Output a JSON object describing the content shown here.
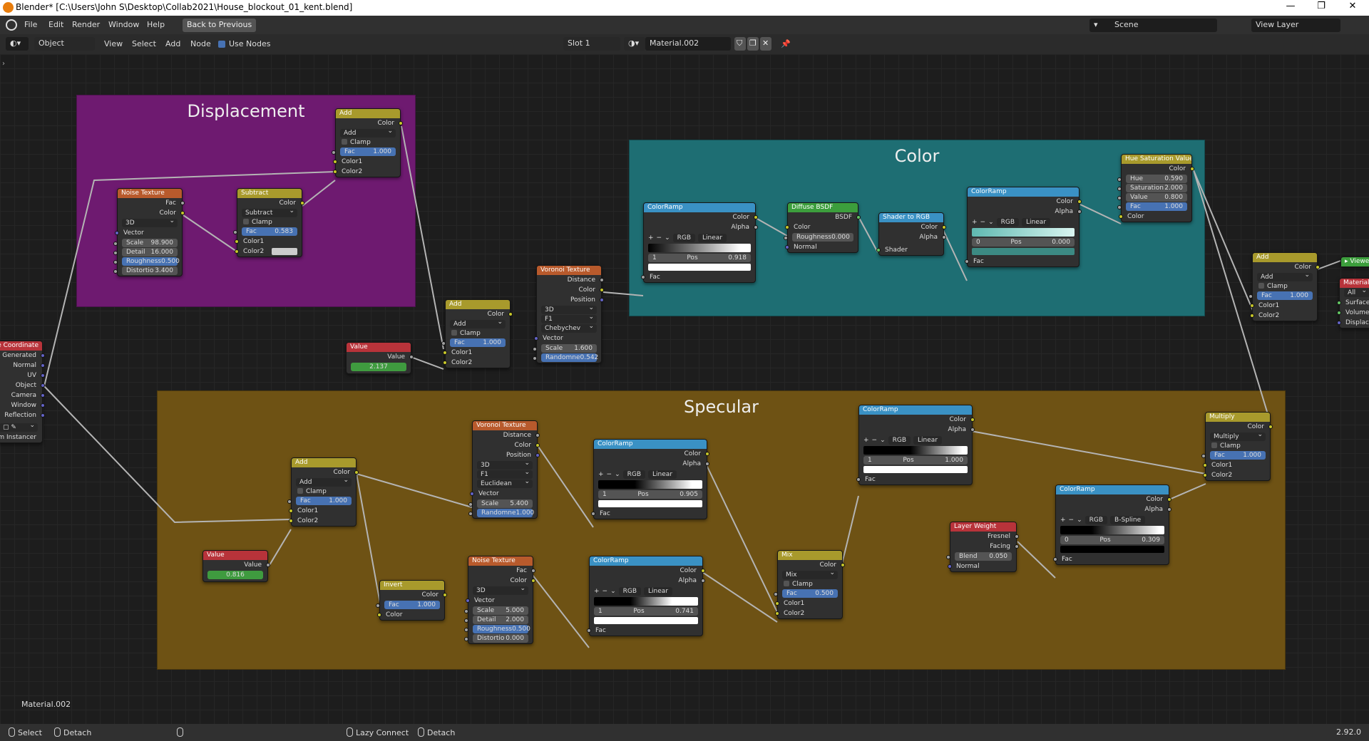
{
  "window": {
    "title": "Blender* [C:\\Users\\John S\\Desktop\\Collab2021\\House_blockout_01_kent.blend]",
    "controls": [
      "—",
      "❐",
      "✕"
    ]
  },
  "menubar": {
    "items": [
      "File",
      "Edit",
      "Render",
      "Window",
      "Help"
    ],
    "back_button": "Back to Previous",
    "scene": "Scene",
    "view_layer": "View Layer"
  },
  "header": {
    "mode": "Object",
    "menus": [
      "View",
      "Select",
      "Add",
      "Node"
    ],
    "use_nodes": "Use Nodes",
    "slot": "Slot 1",
    "material": "Material.002"
  },
  "frames": {
    "displacement": "Displacement",
    "color": "Color",
    "specular": "Specular"
  },
  "nodes": {
    "texcoord": {
      "title": "Texture Coordinate",
      "outputs": [
        "Generated",
        "Normal",
        "UV",
        "Object",
        "Camera",
        "Window",
        "Reflection"
      ],
      "instancer": "From Instancer"
    },
    "noise1": {
      "title": "Noise Texture",
      "out1": "Fac",
      "out2": "Color",
      "dim": "3D",
      "vector": "Vector",
      "scale_l": "Scale",
      "scale_v": "98.900",
      "detail_l": "Detail",
      "detail_v": "16.000",
      "rough_l": "Roughness",
      "rough_v": "0.500",
      "dist_l": "Distortio",
      "dist_v": "3.400"
    },
    "subtract": {
      "title": "Subtract",
      "out": "Color",
      "op": "Subtract",
      "clamp": "Clamp",
      "fac_l": "Fac",
      "fac_v": "0.583",
      "c1": "Color1",
      "c2": "Color2"
    },
    "add_disp": {
      "title": "Add",
      "out": "Color",
      "op": "Add",
      "clamp": "Clamp",
      "fac_l": "Fac",
      "fac_v": "1.000",
      "c1": "Color1",
      "c2": "Color2"
    },
    "value_mid": {
      "title": "Value",
      "out": "Value",
      "val": "2.137"
    },
    "add_mid": {
      "title": "Add",
      "out": "Color",
      "op": "Add",
      "clamp": "Clamp",
      "fac_l": "Fac",
      "fac_v": "1.000",
      "c1": "Color1",
      "c2": "Color2"
    },
    "voronoi_mid": {
      "title": "Voronoi Texture",
      "o1": "Distance",
      "o2": "Color",
      "o3": "Position",
      "dim": "3D",
      "f": "F1",
      "metric": "Chebychev",
      "vector": "Vector",
      "scale_l": "Scale",
      "scale_v": "1.600",
      "rand_l": "Randomne",
      "rand_v": "0.542"
    },
    "cr_color1": {
      "title": "ColorRamp",
      "o1": "Color",
      "o2": "Alpha",
      "mode": "RGB",
      "interp": "Linear",
      "idx": "1",
      "pos_l": "Pos",
      "pos_v": "0.918",
      "fac": "Fac"
    },
    "diffuse": {
      "title": "Diffuse BSDF",
      "out": "BSDF",
      "color": "Color",
      "rough_l": "Roughness",
      "rough_v": "0.000",
      "normal": "Normal"
    },
    "shader2rgb": {
      "title": "Shader to RGB",
      "o1": "Color",
      "o2": "Alpha",
      "in": "Shader"
    },
    "cr_color2": {
      "title": "ColorRamp",
      "o1": "Color",
      "o2": "Alpha",
      "mode": "RGB",
      "interp": "Linear",
      "idx": "0",
      "pos_l": "Pos",
      "pos_v": "0.000",
      "fac": "Fac"
    },
    "huesat": {
      "title": "Hue Saturation Value",
      "out": "Color",
      "hue_l": "Hue",
      "hue_v": "0.590",
      "sat_l": "Saturation",
      "sat_v": "2.000",
      "val_l": "Value",
      "val_v": "0.800",
      "fac_l": "Fac",
      "fac_v": "1.000",
      "color": "Color"
    },
    "add_right": {
      "title": "Add",
      "out": "Color",
      "op": "Add",
      "clamp": "Clamp",
      "fac_l": "Fac",
      "fac_v": "1.000",
      "c1": "Color1",
      "c2": "Color2"
    },
    "viewer": {
      "title": "Viewer"
    },
    "matout": {
      "title": "Material Output",
      "target": "All",
      "i1": "Surface",
      "i2": "Volume",
      "i3": "Displacement"
    },
    "add_spec": {
      "title": "Add",
      "out": "Color",
      "op": "Add",
      "clamp": "Clamp",
      "fac_l": "Fac",
      "fac_v": "1.000",
      "c1": "Color1",
      "c2": "Color2"
    },
    "value_spec": {
      "title": "Value",
      "out": "Value",
      "val": "0.816"
    },
    "invert": {
      "title": "Invert",
      "out": "Color",
      "fac_l": "Fac",
      "fac_v": "1.000",
      "color": "Color"
    },
    "voronoi_spec": {
      "title": "Voronoi Texture",
      "o1": "Distance",
      "o2": "Color",
      "o3": "Position",
      "dim": "3D",
      "f": "F1",
      "metric": "Euclidean",
      "vector": "Vector",
      "scale_l": "Scale",
      "scale_v": "5.400",
      "rand_l": "Randomne",
      "rand_v": "1.000"
    },
    "noise_spec": {
      "title": "Noise Texture",
      "out1": "Fac",
      "out2": "Color",
      "dim": "3D",
      "vector": "Vector",
      "scale_l": "Scale",
      "scale_v": "5.000",
      "detail_l": "Detail",
      "detail_v": "2.000",
      "rough_l": "Roughness",
      "rough_v": "0.500",
      "dist_l": "Distortio",
      "dist_v": "0.000"
    },
    "cr_spec1": {
      "title": "ColorRamp",
      "o1": "Color",
      "o2": "Alpha",
      "mode": "RGB",
      "interp": "Linear",
      "idx": "1",
      "pos_l": "Pos",
      "pos_v": "0.905",
      "fac": "Fac"
    },
    "cr_spec2": {
      "title": "ColorRamp",
      "o1": "Color",
      "o2": "Alpha",
      "mode": "RGB",
      "interp": "Linear",
      "idx": "1",
      "pos_l": "Pos",
      "pos_v": "0.741",
      "fac": "Fac"
    },
    "mix": {
      "title": "Mix",
      "out": "Color",
      "op": "Mix",
      "clamp": "Clamp",
      "fac_l": "Fac",
      "fac_v": "0.500",
      "c1": "Color1",
      "c2": "Color2"
    },
    "cr_spec3": {
      "title": "ColorRamp",
      "o1": "Color",
      "o2": "Alpha",
      "mode": "RGB",
      "interp": "Linear",
      "idx": "1",
      "pos_l": "Pos",
      "pos_v": "1.000",
      "fac": "Fac"
    },
    "layerweight": {
      "title": "Layer Weight",
      "o1": "Fresnel",
      "o2": "Facing",
      "blend_l": "Blend",
      "blend_v": "0.050",
      "normal": "Normal"
    },
    "cr_spec4": {
      "title": "ColorRamp",
      "o1": "Color",
      "o2": "Alpha",
      "mode": "RGB",
      "interp": "B-Spline",
      "idx": "0",
      "pos_l": "Pos",
      "pos_v": "0.309",
      "fac": "Fac"
    },
    "multiply": {
      "title": "Multiply",
      "out": "Color",
      "op": "Multiply",
      "clamp": "Clamp",
      "fac_l": "Fac",
      "fac_v": "1.000",
      "c1": "Color1",
      "c2": "Color2"
    }
  },
  "overlay_material": "Material.002",
  "status": {
    "select": "Select",
    "detach": "Detach",
    "lazy": "Lazy Connect",
    "detach2": "Detach",
    "version": "2.92.0"
  },
  "colors": {
    "frame_displacement": "#6e1a70",
    "frame_color": "#1e6e73",
    "frame_specular": "#6e5214",
    "header_converter": "#3a91c4",
    "header_texture": "#b85a2c",
    "header_color": "#a89a2c",
    "header_shader": "#3c9e3c",
    "header_input": "#b8333a"
  }
}
